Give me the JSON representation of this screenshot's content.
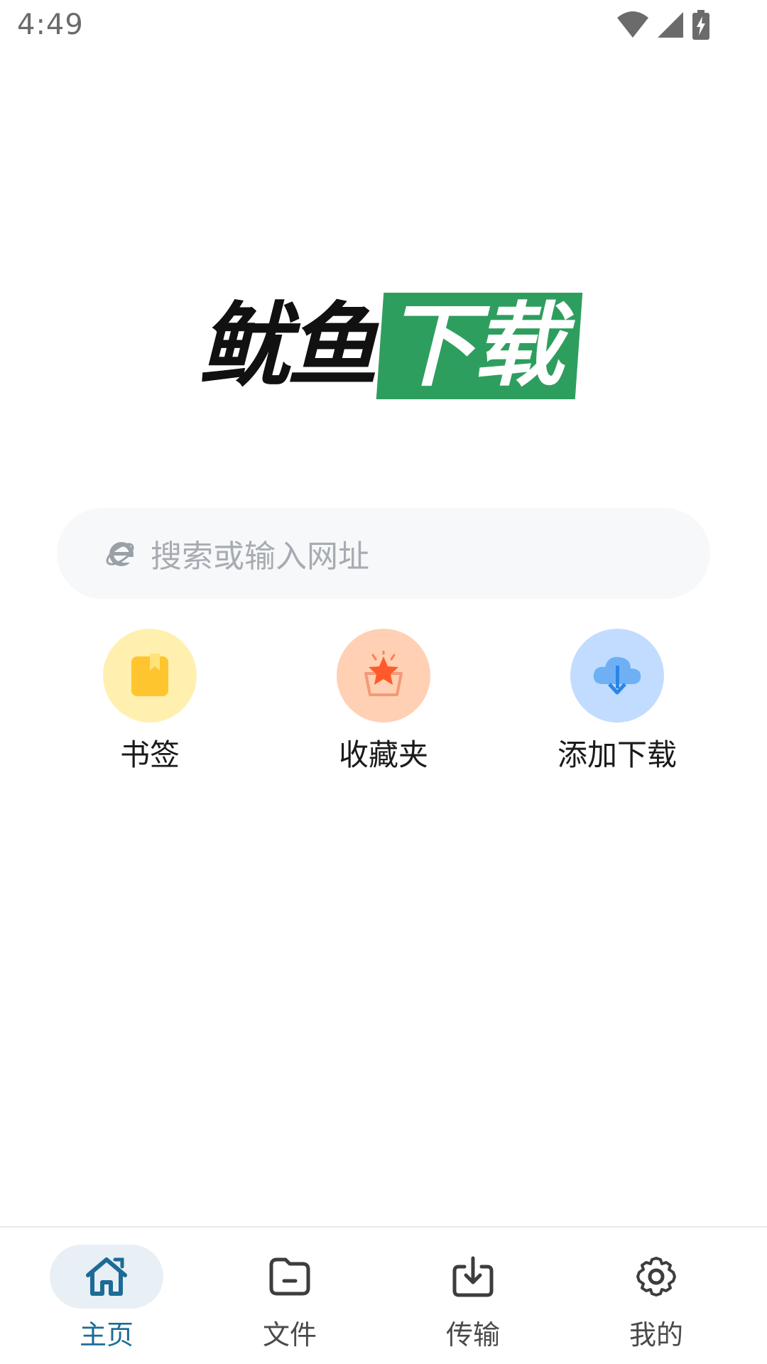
{
  "status_bar": {
    "time": "4:49",
    "icons": [
      "wifi-icon",
      "cell-signal-icon",
      "battery-charging-icon"
    ]
  },
  "logo": {
    "part_black": "鱿鱼",
    "part_green": "下载",
    "green_color": "#2e9e5f"
  },
  "search": {
    "icon": "browser-e-icon",
    "placeholder": "搜索或输入网址"
  },
  "quick_actions": [
    {
      "label": "书签",
      "icon": "bookmark-icon",
      "bg": "#fff0b0"
    },
    {
      "label": "收藏夹",
      "icon": "favorites-star-icon",
      "bg": "#ffd0b3"
    },
    {
      "label": "添加下载",
      "icon": "cloud-download-icon",
      "bg": "#c1dcff"
    }
  ],
  "bottom_nav": [
    {
      "label": "主页",
      "icon": "home-icon",
      "active": true
    },
    {
      "label": "文件",
      "icon": "folder-icon",
      "active": false
    },
    {
      "label": "传输",
      "icon": "download-tray-icon",
      "active": false
    },
    {
      "label": "我的",
      "icon": "gear-icon",
      "active": false
    }
  ],
  "colors": {
    "accent": "#1d6b96",
    "active_nav_bg": "#e8eff5",
    "search_bg": "#f7f8f9"
  }
}
